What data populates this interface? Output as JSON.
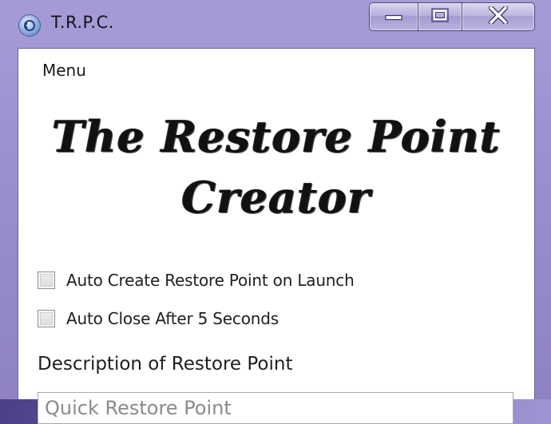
{
  "window": {
    "title": "T.R.P.C.",
    "icon": "app-restore-icon"
  },
  "caption_buttons": {
    "minimize_icon": "minimize-icon",
    "maximize_icon": "maximize-icon",
    "close_icon": "close-icon"
  },
  "menu": {
    "items": [
      {
        "label": "Menu"
      }
    ]
  },
  "banner": {
    "line1": "The Restore Point",
    "line2": "Creator"
  },
  "options": {
    "auto_create_label": "Auto Create Restore Point on Launch",
    "auto_create_checked": false,
    "auto_close_label": "Auto Close After 5 Seconds",
    "auto_close_checked": false
  },
  "description": {
    "label": "Description of Restore Point",
    "value": "Quick Restore Point"
  }
}
